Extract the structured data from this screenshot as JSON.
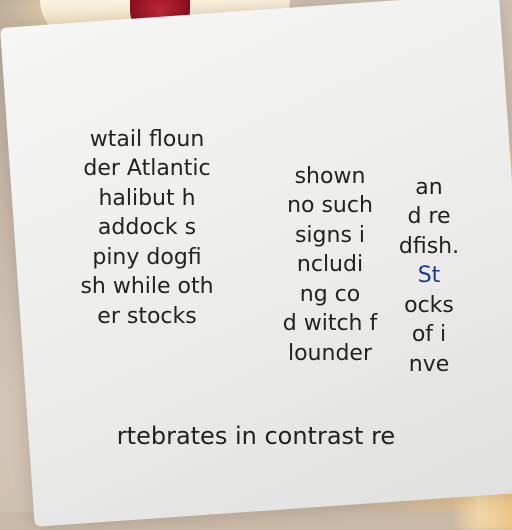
{
  "col1": [
    "wtail floun",
    "der Atlantic",
    "halibut h",
    "addock s",
    "piny dogfi",
    "sh while oth",
    "er stocks"
  ],
  "col2": [
    "shown",
    "no such",
    "signs i",
    "ncludi",
    "ng co",
    "d witch f",
    "lounder"
  ],
  "col3": [
    "an",
    "d re",
    "dfish.",
    "St",
    "ocks",
    "of i",
    "nve"
  ],
  "bottom": "rtebrates in contrast re"
}
